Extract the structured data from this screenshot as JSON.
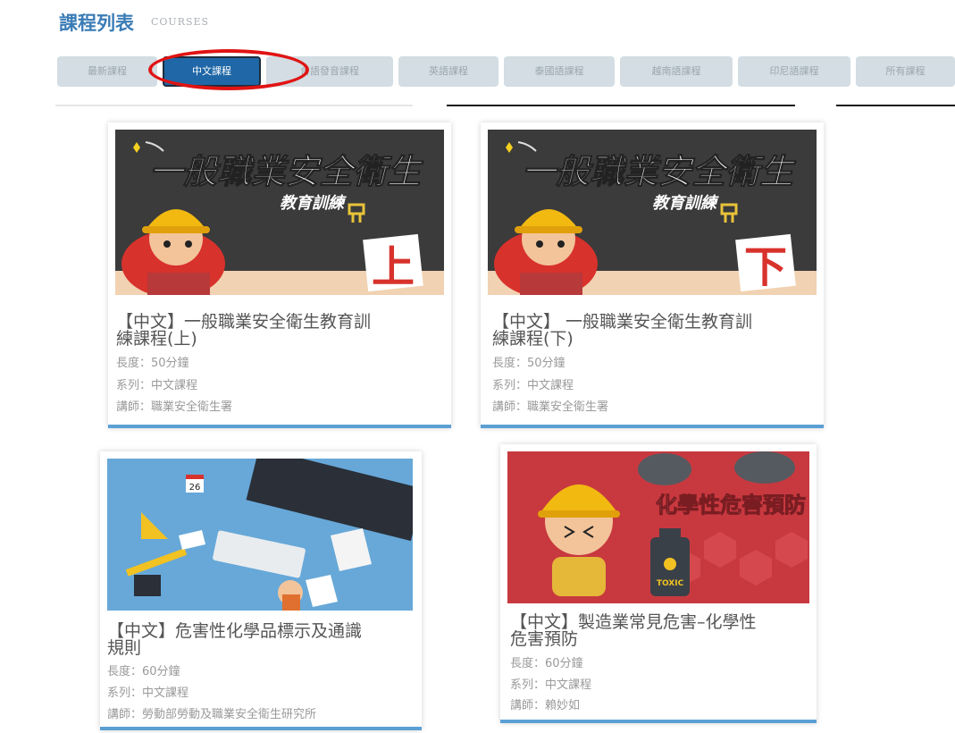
{
  "header": {
    "title": "課程列表",
    "subtitle": "COURSES"
  },
  "tabs": [
    {
      "label": "最新課程",
      "active": false
    },
    {
      "label": "中文課程",
      "active": true
    },
    {
      "label": "台語發音課程",
      "active": false
    },
    {
      "label": "英語課程",
      "active": false
    },
    {
      "label": "泰國語課程",
      "active": false
    },
    {
      "label": "越南語課程",
      "active": false
    },
    {
      "label": "印尼語課程",
      "active": false
    },
    {
      "label": "所有課程",
      "active": false
    }
  ],
  "courses": [
    {
      "title_line1": "【中文】一般職業安全衛生教育訓",
      "title_line2": "練課程(上)",
      "length": "長度：50分鐘",
      "series": "系列：中文課程",
      "teacher": "講師：職業安全衛生署",
      "thumb": {
        "heading": "一般職業安全衛生",
        "sub": "教育訓練",
        "badge": "上"
      }
    },
    {
      "title_line1": "【中文】 一般職業安全衛生教育訓",
      "title_line2": "練課程(下)",
      "length": "長度：50分鐘",
      "series": "系列：中文課程",
      "teacher": "講師：職業安全衛生署",
      "thumb": {
        "heading": "一般職業安全衛生",
        "sub": "教育訓練",
        "badge": "下"
      }
    },
    {
      "title_line1": "【中文】危害性化學品標示及通識",
      "title_line2": "規則",
      "length": "長度：60分鐘",
      "series": "系列：中文課程",
      "teacher": "講師：勞動部勞動及職業安全衛生研究所",
      "thumb": {
        "calendar": "26"
      }
    },
    {
      "title_line1": "【中文】製造業常見危害–化學性",
      "title_line2": "危害預防",
      "length": "長度：60分鐘",
      "series": "系列：中文課程",
      "teacher": "講師：賴妙如",
      "thumb": {
        "heading": "化學性危害預防",
        "toxic": "TOXIC"
      }
    }
  ],
  "colors": {
    "accent": "#1f67a6",
    "title": "#3a7cb6",
    "highlight": "#e01414",
    "card_border": "#5b9fd4"
  }
}
